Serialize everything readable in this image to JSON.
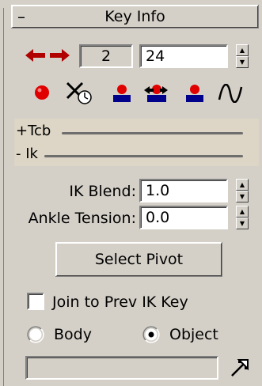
{
  "rollout": {
    "collapse_symbol": "–",
    "title": "Key Info"
  },
  "key_nav": {
    "prev_icon": "arrow-left-icon",
    "next_icon": "arrow-right-icon",
    "key_number": "2",
    "time_value": "24",
    "arrow_color": "#b00000"
  },
  "key_tools": [
    {
      "icon": "set-key-icon"
    },
    {
      "icon": "no-key-icon"
    },
    {
      "icon": "key-pivot-icon"
    },
    {
      "icon": "key-move-pivot-icon"
    },
    {
      "icon": "key-pivot-2-icon"
    },
    {
      "icon": "curve-icon"
    }
  ],
  "tracks": {
    "tcb_label": "+Tcb",
    "ik_label": "- Ik"
  },
  "ik_blend": {
    "label": "IK Blend:",
    "value": "1.0"
  },
  "ankle_tension": {
    "label": "Ankle Tension:",
    "value": "0.0"
  },
  "select_pivot": {
    "label": "Select Pivot"
  },
  "join_prev": {
    "label": "Join to Prev IK Key",
    "checked": false
  },
  "space": {
    "options": [
      "Body",
      "Object"
    ],
    "selected": "Object"
  },
  "object_field": {
    "value": ""
  },
  "colors": {
    "panel_bg": "#d4d0c8",
    "accent_red": "#e00000",
    "accent_blue": "#00008b"
  }
}
